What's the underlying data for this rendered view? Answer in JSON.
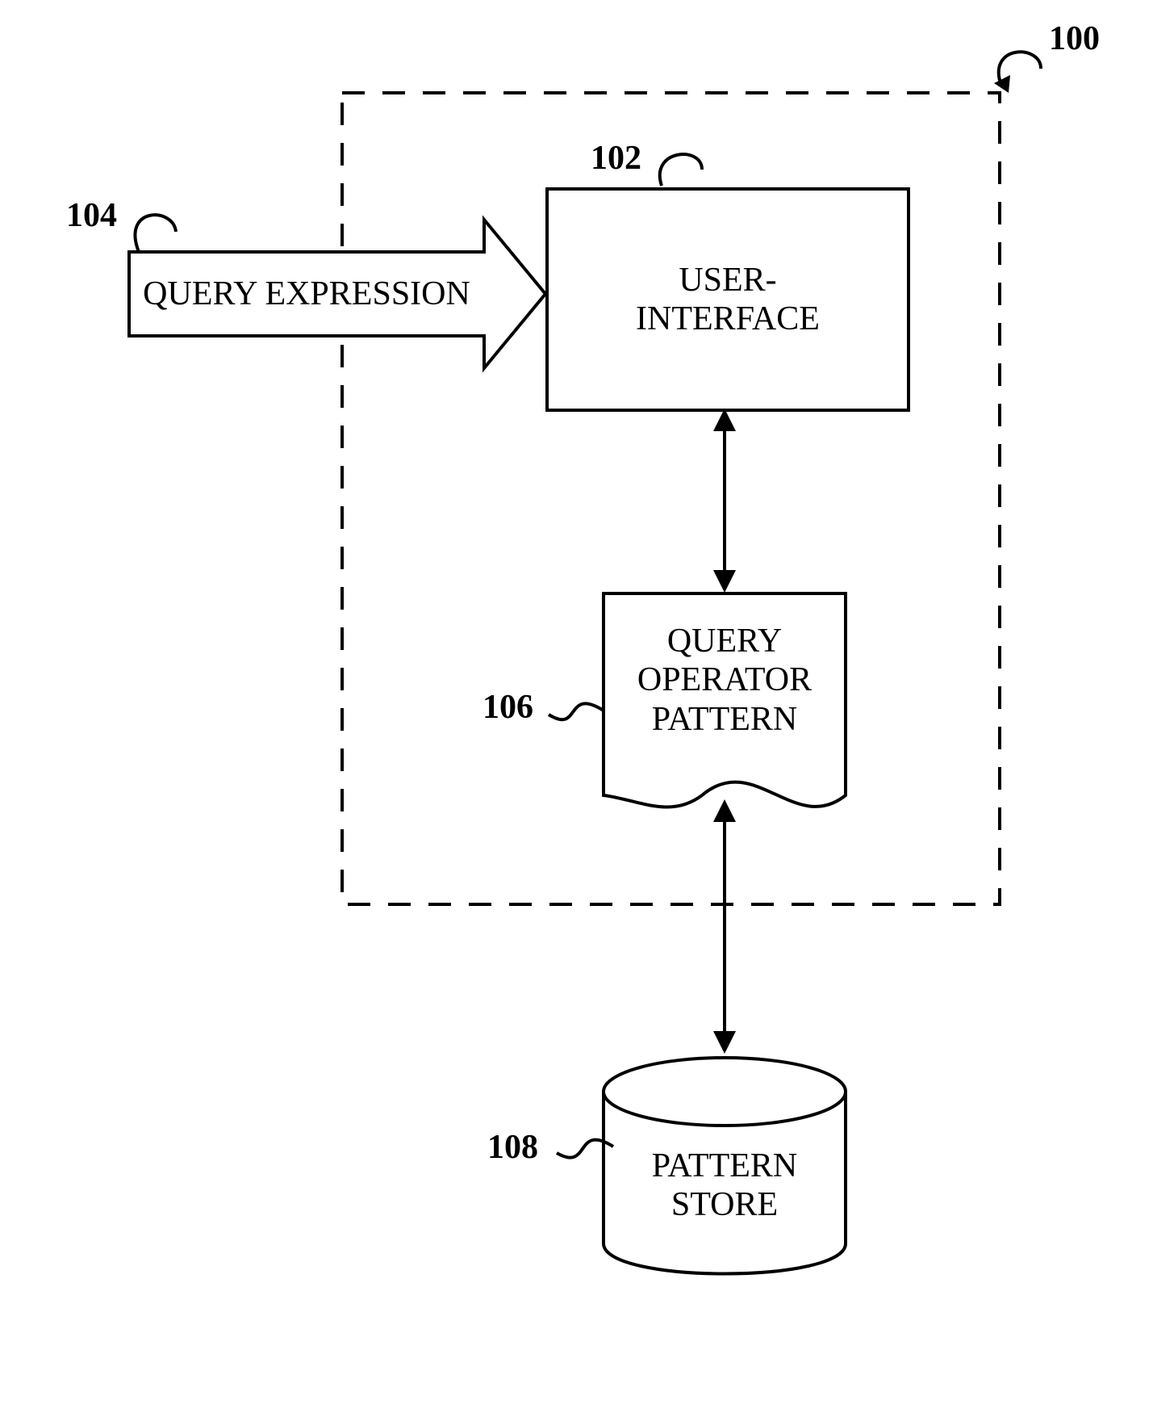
{
  "refs": {
    "system": "100",
    "user_interface": "102",
    "query_expression": "104",
    "query_operator_pattern": "106",
    "pattern_store": "108"
  },
  "labels": {
    "query_expression": "QUERY EXPRESSION",
    "user_interface_line1": "USER-",
    "user_interface_line2": "INTERFACE",
    "query_operator_pattern_line1": "QUERY",
    "query_operator_pattern_line2": "OPERATOR",
    "query_operator_pattern_line3": "PATTERN",
    "pattern_store_line1": "PATTERN",
    "pattern_store_line2": "STORE"
  }
}
